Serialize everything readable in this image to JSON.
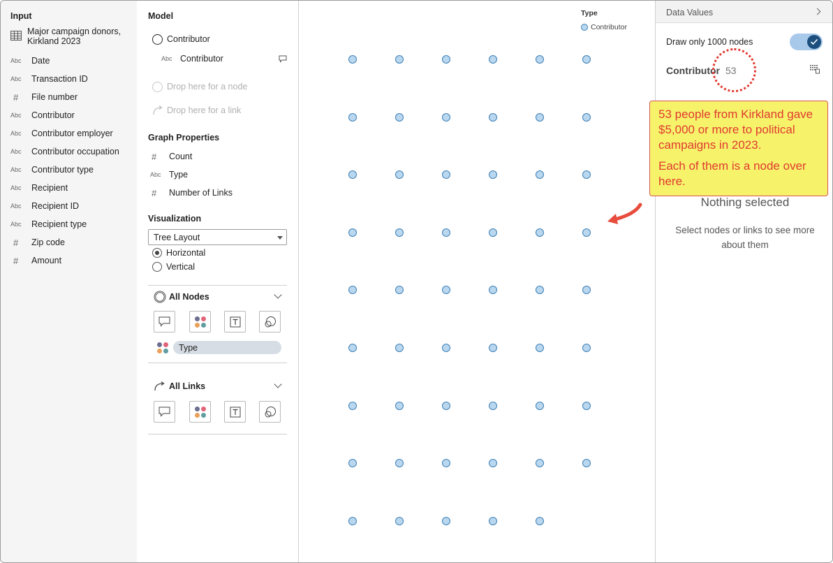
{
  "input": {
    "title": "Input",
    "source": "Major campaign donors, Kirkland 2023",
    "fields": [
      {
        "type": "Abc",
        "label": "Date"
      },
      {
        "type": "Abc",
        "label": "Transaction ID"
      },
      {
        "type": "#",
        "label": "File number"
      },
      {
        "type": "Abc",
        "label": "Contributor"
      },
      {
        "type": "Abc",
        "label": "Contributor employer"
      },
      {
        "type": "Abc",
        "label": "Contributor occupation"
      },
      {
        "type": "Abc",
        "label": "Contributor type"
      },
      {
        "type": "Abc",
        "label": "Recipient"
      },
      {
        "type": "Abc",
        "label": "Recipient ID"
      },
      {
        "type": "Abc",
        "label": "Recipient type"
      },
      {
        "type": "#",
        "label": "Zip code"
      },
      {
        "type": "#",
        "label": "Amount"
      }
    ]
  },
  "model": {
    "title": "Model",
    "node_type": "Contributor",
    "node_field_type": "Abc",
    "node_field": "Contributor",
    "drop_node": "Drop here for a node",
    "drop_link": "Drop here for a link"
  },
  "graph_properties": {
    "title": "Graph Properties",
    "items": [
      {
        "type": "#",
        "label": "Count"
      },
      {
        "type": "Abc",
        "label": "Type"
      },
      {
        "type": "#",
        "label": "Number of Links"
      }
    ]
  },
  "visualization": {
    "title": "Visualization",
    "layout": "Tree Layout",
    "orientation_options": [
      "Horizontal",
      "Vertical"
    ],
    "selected_orientation": "Horizontal"
  },
  "all_nodes": {
    "title": "All Nodes",
    "color_field": "Type"
  },
  "all_links": {
    "title": "All Links"
  },
  "canvas": {
    "legend_title": "Type",
    "legend_item": "Contributor",
    "node_count": 53,
    "node_color": "#b9d7ef",
    "node_border": "#3d7fb5"
  },
  "data_values": {
    "header": "Data Values",
    "toggle_label": "Draw only 1000 nodes",
    "toggle_on": true,
    "entity": "Contributor",
    "count": "53",
    "empty_title": "Nothing selected",
    "empty_hint": "Select nodes or links to see more about them"
  },
  "annotation": {
    "line1": "53 people from Kirkland gave $5,000 or more to political campaigns in 2023.",
    "line2": "Each of them is a node over here.",
    "color": "#e0392f",
    "fill": "#f6f36b"
  }
}
